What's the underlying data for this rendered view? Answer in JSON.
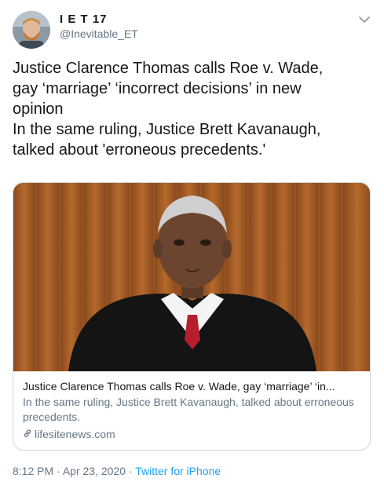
{
  "user": {
    "display_name": "I E T 17",
    "handle": "@Inevitable_ET"
  },
  "tweet": {
    "lines": [
      "Justice Clarence Thomas calls Roe v. Wade,",
      "gay ‘marriage’ ‘incorrect decisions’ in new",
      "opinion",
      "In the same ruling, Justice Brett Kavanaugh,",
      "talked about 'erroneous precedents.'"
    ]
  },
  "card": {
    "title": "Justice Clarence Thomas calls Roe v. Wade, gay ‘marriage’ ‘in...",
    "description": "In the same ruling, Justice Brett Kavanaugh, talked about erroneous precedents.",
    "domain": "lifesitenews.com",
    "link_icon": "link-icon"
  },
  "footer": {
    "time": "8:12 PM",
    "separator1": "·",
    "date": "Apr 23, 2020",
    "separator2": "·",
    "source": "Twitter for iPhone"
  },
  "icons": {
    "caret": "chevron-down-icon"
  },
  "colors": {
    "text": "#14171a",
    "secondary": "#657786",
    "accent": "#1da1f2",
    "border": "#ccd6dd"
  }
}
